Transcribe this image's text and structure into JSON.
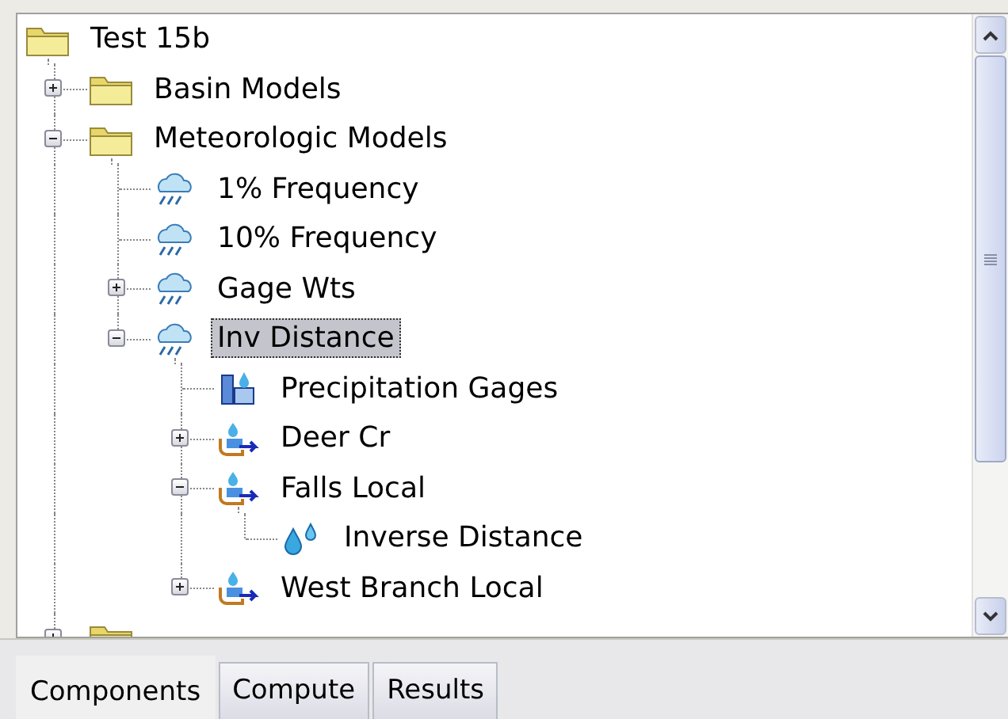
{
  "tree": {
    "label": "Test 15b",
    "kind": "folder",
    "selected": false,
    "children": [
      {
        "label": "Basin Models",
        "kind": "folder",
        "expanded": false,
        "selected": false
      },
      {
        "label": "Meteorologic Models",
        "kind": "folder",
        "expanded": true,
        "selected": false,
        "children": [
          {
            "label": "1% Frequency",
            "kind": "meteo",
            "selected": false
          },
          {
            "label": "10% Frequency",
            "kind": "meteo",
            "selected": false
          },
          {
            "label": "Gage Wts",
            "kind": "meteo",
            "expanded": false,
            "selected": false
          },
          {
            "label": "Inv Distance",
            "kind": "meteo",
            "expanded": true,
            "selected": true,
            "children": [
              {
                "label": "Precipitation Gages",
                "kind": "gages",
                "selected": false
              },
              {
                "label": "Deer Cr",
                "kind": "subbasin",
                "expanded": false,
                "selected": false
              },
              {
                "label": "Falls Local",
                "kind": "subbasin",
                "expanded": true,
                "selected": false,
                "children": [
                  {
                    "label": "Inverse Distance",
                    "kind": "method",
                    "selected": false
                  }
                ]
              },
              {
                "label": "West Branch Local",
                "kind": "subbasin",
                "expanded": false,
                "selected": false
              }
            ]
          }
        ]
      },
      {
        "kind": "folder",
        "expanded": false
      }
    ]
  },
  "tabs": [
    {
      "label": "Components",
      "selected": true
    },
    {
      "label": "Compute",
      "selected": false
    },
    {
      "label": "Results",
      "selected": false
    }
  ]
}
